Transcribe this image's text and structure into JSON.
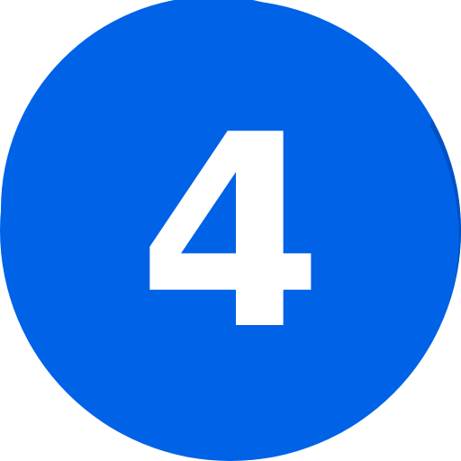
{
  "badge": {
    "number": "4",
    "colors": {
      "circle": "#0062e6",
      "shadow": "#0052c4",
      "digit": "#ffffff"
    }
  }
}
